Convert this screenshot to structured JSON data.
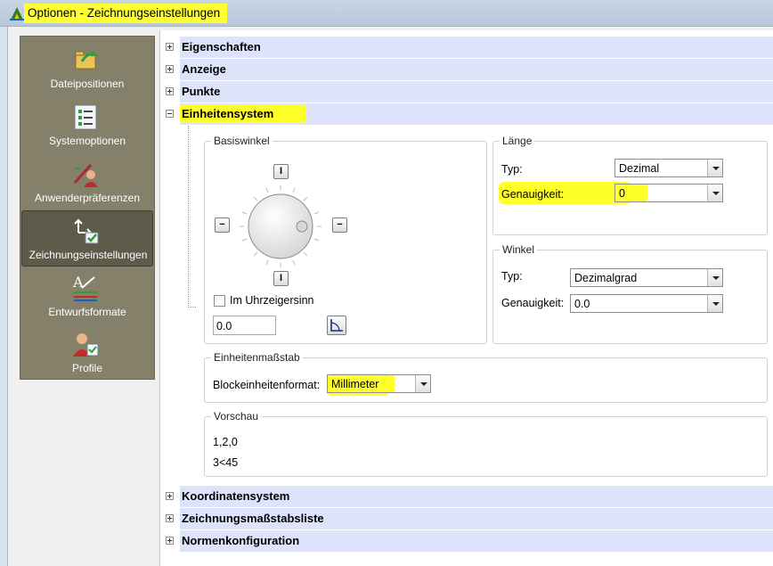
{
  "window": {
    "title": "Optionen - Zeichnungseinstellungen"
  },
  "nav": {
    "items": [
      {
        "label": "Dateipositionen",
        "icon": "file-locations-icon"
      },
      {
        "label": "Systemoptionen",
        "icon": "system-options-icon"
      },
      {
        "label": "Anwenderpräferenzen",
        "icon": "user-preferences-icon"
      },
      {
        "label": "Zeichnungseinstellungen",
        "icon": "drawing-settings-icon",
        "active": true
      },
      {
        "label": "Entwurfsformate",
        "icon": "drafting-styles-icon"
      },
      {
        "label": "Profile",
        "icon": "profiles-icon"
      }
    ]
  },
  "tree": {
    "top": [
      "Eigenschaften",
      "Anzeige",
      "Punkte"
    ],
    "expanded": "Einheitensystem",
    "bottom": [
      "Koordinatensystem",
      "Zeichnungsmaßstabsliste",
      "Normenkonfiguration"
    ]
  },
  "basiswinkel": {
    "title": "Basiswinkel",
    "clockwise_label": "Im Uhrzeigersinn",
    "clockwise_checked": false,
    "angle_value": "0.0"
  },
  "laenge": {
    "title": "Länge",
    "type_label": "Typ:",
    "type_value": "Dezimal",
    "precision_label": "Genauigkeit:",
    "precision_value": "0"
  },
  "winkel": {
    "title": "Winkel",
    "type_label": "Typ:",
    "type_value": "Dezimalgrad",
    "precision_label": "Genauigkeit:",
    "precision_value": "0.0"
  },
  "einheitenmassstab": {
    "title": "Einheitenmaßstab",
    "block_label": "Blockeinheitenformat:",
    "block_value": "Millimeter"
  },
  "vorschau": {
    "title": "Vorschau",
    "line1": "1,2,0",
    "line2": "3<45"
  },
  "colors": {
    "highlight": "#ffff2a",
    "nav_bg": "#85806a",
    "tree_row_bg": "#dde3fb"
  }
}
